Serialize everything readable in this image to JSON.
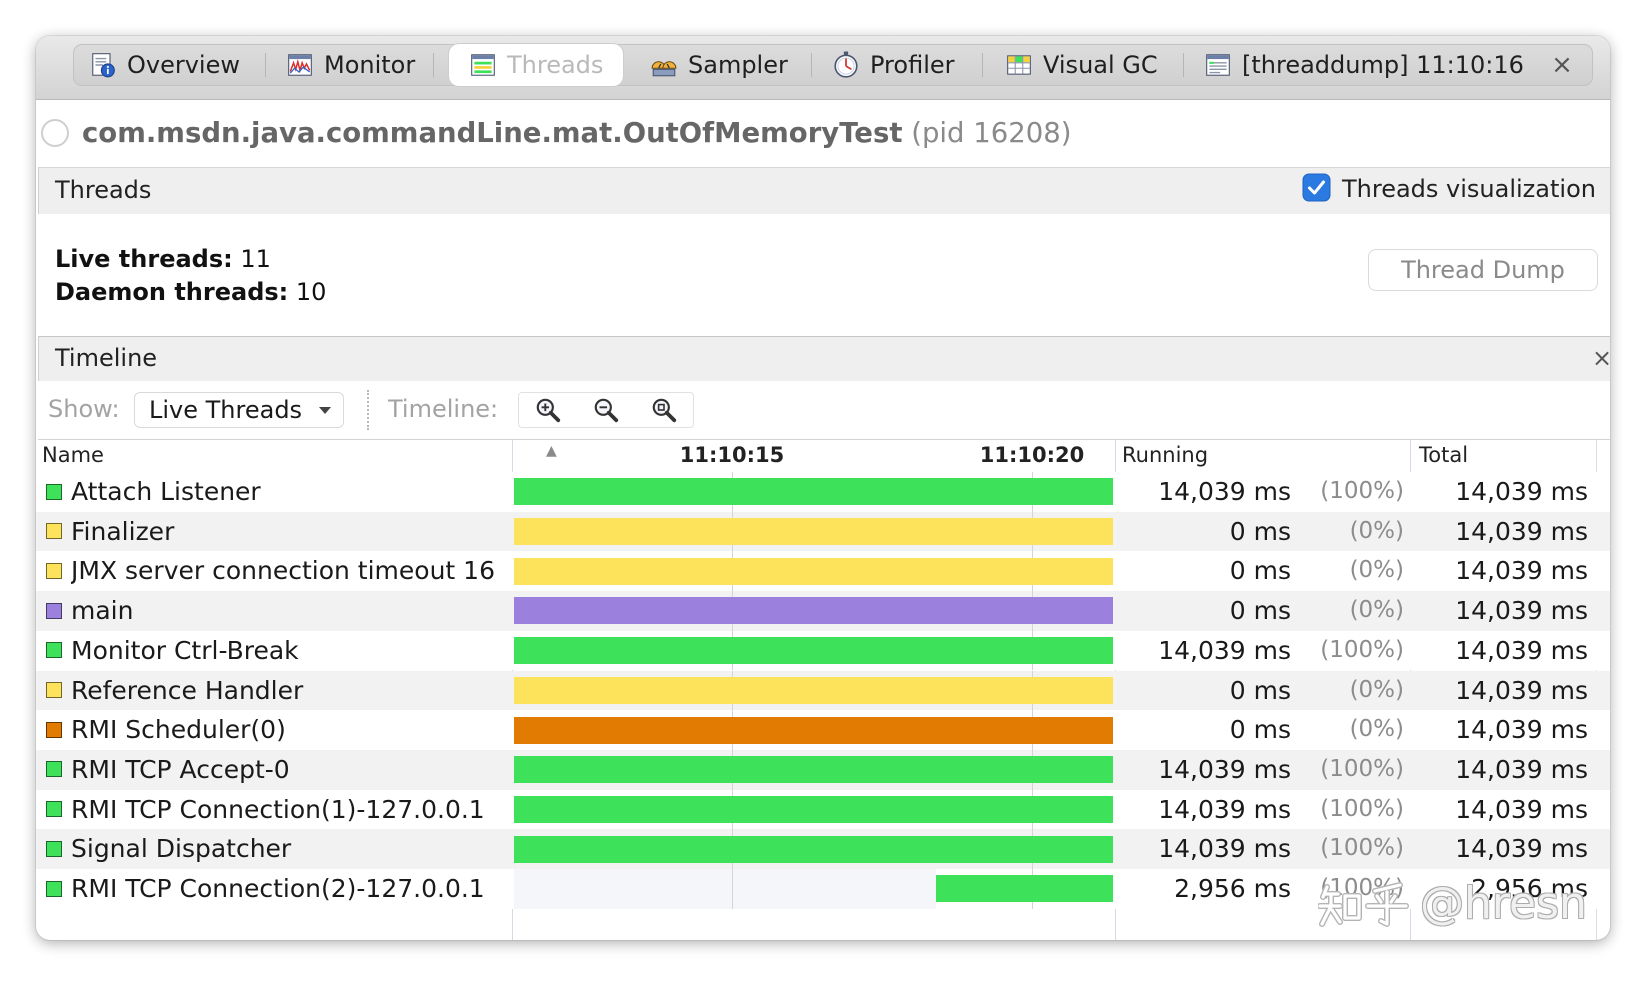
{
  "tabs": [
    {
      "label": "Overview",
      "icon": "overview-icon",
      "selected": false
    },
    {
      "label": "Monitor",
      "icon": "monitor-icon",
      "selected": false
    },
    {
      "label": "Threads",
      "icon": "threads-icon",
      "selected": true
    },
    {
      "label": "Sampler",
      "icon": "sampler-icon",
      "selected": false
    },
    {
      "label": "Profiler",
      "icon": "profiler-icon",
      "selected": false
    },
    {
      "label": "Visual GC",
      "icon": "visual-gc-icon",
      "selected": false
    },
    {
      "label": "[threaddump] 11:10:16",
      "icon": "threaddump-icon",
      "selected": false,
      "close": "×"
    }
  ],
  "app": {
    "name": "com.msdn.java.commandLine.mat.OutOfMemoryTest",
    "pid": "(pid 16208)",
    "status_icon": "status-circle-icon"
  },
  "threads_panel": {
    "title": "Threads",
    "visualization_label": "Threads visualization",
    "visualization_checked": true,
    "live_label": "Live threads:",
    "live_value": "11",
    "daemon_label": "Daemon threads:",
    "daemon_value": "10",
    "dump_button": "Thread Dump"
  },
  "timeline_panel": {
    "title": "Timeline",
    "close": "×",
    "show_label": "Show:",
    "show_value": "Live Threads",
    "timeline_label": "Timeline:",
    "zoom": [
      "zoom-in-icon",
      "zoom-out-icon",
      "zoom-fit-icon"
    ]
  },
  "table": {
    "columns": {
      "name": "Name",
      "timeline_sort": "▲",
      "running": "Running",
      "total": "Total"
    },
    "ticks": [
      "11:10:15",
      "11:10:20"
    ],
    "rows": [
      {
        "name": "Attach Listener",
        "color": "#3de25a",
        "running": "14,039 ms",
        "running_pct": "(100%)",
        "total": "14,039 ms",
        "total_ms": 14039
      },
      {
        "name": "Finalizer",
        "color": "#fde25c",
        "running": "0 ms",
        "running_pct": "(0%)",
        "total": "14,039 ms",
        "total_ms": 14039
      },
      {
        "name": "JMX server connection timeout 16",
        "color": "#fde25c",
        "running": "0 ms",
        "running_pct": "(0%)",
        "total": "14,039 ms",
        "total_ms": 14039
      },
      {
        "name": "main",
        "color": "#9c80dd",
        "running": "0 ms",
        "running_pct": "(0%)",
        "total": "14,039 ms",
        "total_ms": 14039
      },
      {
        "name": "Monitor Ctrl-Break",
        "color": "#3de25a",
        "running": "14,039 ms",
        "running_pct": "(100%)",
        "total": "14,039 ms",
        "total_ms": 14039
      },
      {
        "name": "Reference Handler",
        "color": "#fde25c",
        "running": "0 ms",
        "running_pct": "(0%)",
        "total": "14,039 ms",
        "total_ms": 14039
      },
      {
        "name": "RMI Scheduler(0)",
        "color": "#e17b02",
        "running": "0 ms",
        "running_pct": "(0%)",
        "total": "14,039 ms",
        "total_ms": 14039
      },
      {
        "name": "RMI TCP Accept-0",
        "color": "#3de25a",
        "running": "14,039 ms",
        "running_pct": "(100%)",
        "total": "14,039 ms",
        "total_ms": 14039
      },
      {
        "name": "RMI TCP Connection(1)-127.0.0.1",
        "color": "#3de25a",
        "running": "14,039 ms",
        "running_pct": "(100%)",
        "total": "14,039 ms",
        "total_ms": 14039
      },
      {
        "name": "Signal Dispatcher",
        "color": "#3de25a",
        "running": "14,039 ms",
        "running_pct": "(100%)",
        "total": "14,039 ms",
        "total_ms": 14039
      },
      {
        "name": "RMI TCP Connection(2)-127.0.0.1",
        "color": "#3de25a",
        "running": "2,956 ms",
        "running_pct": "(100%)",
        "total": "2,956 ms",
        "total_ms": 2956
      }
    ]
  },
  "accent_color": "#2a7ae2",
  "watermark": {
    "brand": "知乎",
    "handle": "@hresn"
  }
}
